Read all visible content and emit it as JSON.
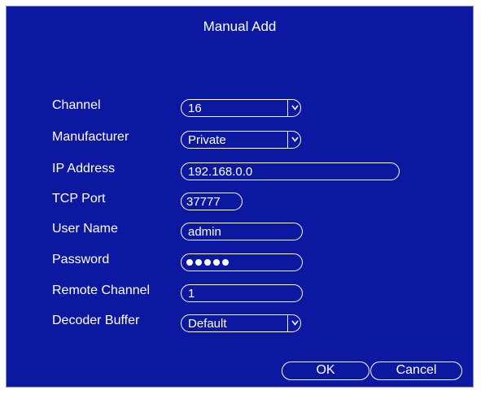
{
  "dialog": {
    "title": "Manual Add"
  },
  "form": {
    "channel": {
      "label": "Channel",
      "value": "16"
    },
    "manufacturer": {
      "label": "Manufacturer",
      "value": "Private"
    },
    "ip_address": {
      "label": "IP Address",
      "value": "192.168.0.0"
    },
    "tcp_port": {
      "label": "TCP Port",
      "value": "37777"
    },
    "user_name": {
      "label": "User Name",
      "value": "admin"
    },
    "password": {
      "label": "Password",
      "masked_length": 5
    },
    "remote_channel": {
      "label": "Remote Channel",
      "value": "1"
    },
    "decoder_buffer": {
      "label": "Decoder Buffer",
      "value": "Default"
    }
  },
  "buttons": {
    "ok_label": "OK",
    "cancel_label": "Cancel"
  },
  "colors": {
    "background": "#0d18a0",
    "foreground": "#ffffff"
  },
  "icons": {
    "dropdown": "chevron-down-icon"
  }
}
